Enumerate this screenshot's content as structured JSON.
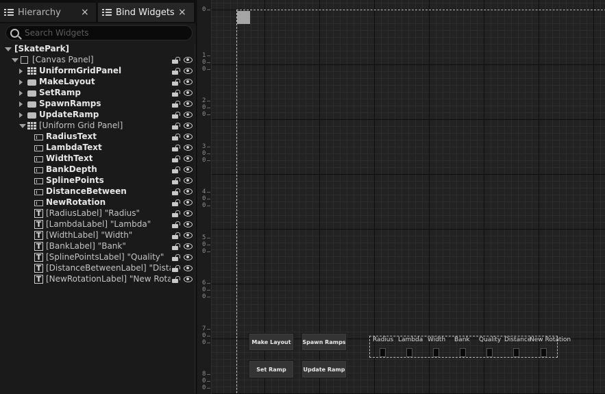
{
  "tabs": [
    {
      "label": "Hierarchy",
      "close": "×"
    },
    {
      "label": "Bind Widgets",
      "close": "×"
    }
  ],
  "search": {
    "placeholder": "Search Widgets"
  },
  "tree": [
    {
      "label": "[SkatePark]",
      "depth": 0,
      "arrow": "down",
      "icon": "none",
      "bold": true,
      "vis": false
    },
    {
      "label": "[Canvas Panel]",
      "depth": 1,
      "arrow": "down",
      "icon": "canvas",
      "bold": false,
      "vis": true
    },
    {
      "label": "UniformGridPanel",
      "depth": 2,
      "arrow": "right",
      "icon": "grid",
      "bold": true,
      "vis": true
    },
    {
      "label": "MakeLayout",
      "depth": 2,
      "arrow": "right",
      "icon": "button",
      "bold": true,
      "vis": true
    },
    {
      "label": "SetRamp",
      "depth": 2,
      "arrow": "right",
      "icon": "button",
      "bold": true,
      "vis": true
    },
    {
      "label": "SpawnRamps",
      "depth": 2,
      "arrow": "right",
      "icon": "button",
      "bold": true,
      "vis": true
    },
    {
      "label": "UpdateRamp",
      "depth": 2,
      "arrow": "right",
      "icon": "button",
      "bold": true,
      "vis": true
    },
    {
      "label": "[Uniform Grid Panel]",
      "depth": 2,
      "arrow": "down",
      "icon": "grid",
      "bold": false,
      "vis": true
    },
    {
      "label": "RadiusText",
      "depth": 3,
      "arrow": "none",
      "icon": "textbox",
      "bold": true,
      "vis": true
    },
    {
      "label": "LambdaText",
      "depth": 3,
      "arrow": "none",
      "icon": "textbox",
      "bold": true,
      "vis": true
    },
    {
      "label": "WidthText",
      "depth": 3,
      "arrow": "none",
      "icon": "textbox",
      "bold": true,
      "vis": true
    },
    {
      "label": "BankDepth",
      "depth": 3,
      "arrow": "none",
      "icon": "textbox",
      "bold": true,
      "vis": true
    },
    {
      "label": "SplinePoints",
      "depth": 3,
      "arrow": "none",
      "icon": "textbox",
      "bold": true,
      "vis": true
    },
    {
      "label": "DistanceBetween",
      "depth": 3,
      "arrow": "none",
      "icon": "textbox",
      "bold": true,
      "vis": true
    },
    {
      "label": "NewRotation",
      "depth": 3,
      "arrow": "none",
      "icon": "textbox",
      "bold": true,
      "vis": true
    },
    {
      "label": "[RadiusLabel] \"Radius\"",
      "depth": 3,
      "arrow": "none",
      "icon": "text",
      "bold": false,
      "vis": true
    },
    {
      "label": "[LambdaLabel] \"Lambda\"",
      "depth": 3,
      "arrow": "none",
      "icon": "text",
      "bold": false,
      "vis": true
    },
    {
      "label": "[WidthLabel] \"Width\"",
      "depth": 3,
      "arrow": "none",
      "icon": "text",
      "bold": false,
      "vis": true
    },
    {
      "label": "[BankLabel] \"Bank\"",
      "depth": 3,
      "arrow": "none",
      "icon": "text",
      "bold": false,
      "vis": true
    },
    {
      "label": "[SplinePointsLabel] \"Quality\"",
      "depth": 3,
      "arrow": "none",
      "icon": "text",
      "bold": false,
      "vis": true
    },
    {
      "label": "[DistanceBetweenLabel] \"Distar",
      "depth": 3,
      "arrow": "none",
      "icon": "text",
      "bold": false,
      "vis": true
    },
    {
      "label": "[NewRotationLabel] \"New Rotati",
      "depth": 3,
      "arrow": "none",
      "icon": "text",
      "bold": false,
      "vis": true
    }
  ],
  "ruler": [
    "0",
    "100",
    "200",
    "300",
    "400",
    "500",
    "600",
    "700",
    "800"
  ],
  "canvas": {
    "buttons": [
      "Make Layout",
      "Spawn Ramps",
      "Set Ramp",
      "Update Ramp"
    ],
    "grid_labels": [
      "Radius",
      "Lambda",
      "Width",
      "Bank",
      "Quality",
      "Distance",
      "New Rotation"
    ]
  }
}
